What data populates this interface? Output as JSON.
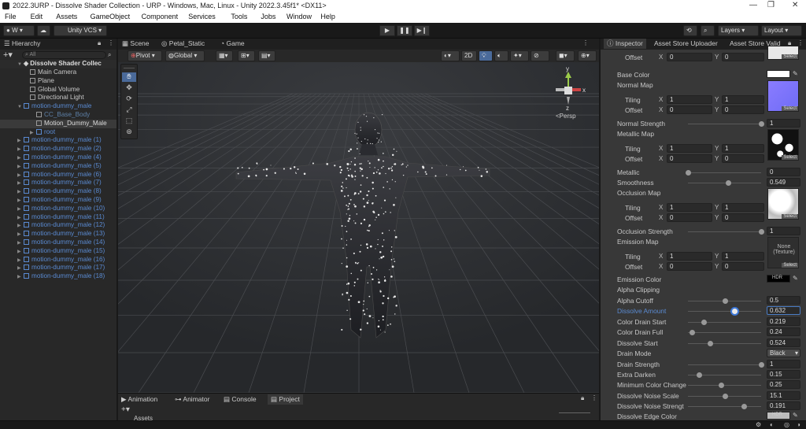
{
  "window": {
    "title": "2022.3URP - Dissolve Shader Collection - URP - Windows, Mac, Linux - Unity 2022.3.45f1* <DX11>"
  },
  "menu": [
    "File",
    "Edit",
    "Assets",
    "GameObject",
    "Component",
    "Services",
    "Tools",
    "Jobs",
    "Window",
    "Help"
  ],
  "toolbar": {
    "account": "W",
    "vcs": "Unity VCS",
    "layers": "Layers",
    "layout": "Layout"
  },
  "hierarchy": {
    "tab": "Hierarchy",
    "search_placeholder": "All",
    "scene": "Dissolve Shader Collec",
    "items": [
      {
        "label": "Main Camera",
        "style": "normal",
        "indent": 2
      },
      {
        "label": "Plane",
        "style": "normal",
        "indent": 2
      },
      {
        "label": "Global Volume",
        "style": "normal",
        "indent": 2
      },
      {
        "label": "Directional Light",
        "style": "normal",
        "indent": 2
      },
      {
        "label": "motion-dummy_male",
        "style": "blue",
        "indent": 1,
        "arrow": "▼"
      },
      {
        "label": "CC_Base_Body",
        "style": "dim",
        "indent": 3
      },
      {
        "label": "Motion_Dummy_Male",
        "style": "sel",
        "indent": 3
      },
      {
        "label": "root",
        "style": "blue",
        "indent": 3,
        "arrow": "▶"
      },
      {
        "label": "motion-dummy_male (1)",
        "style": "blue",
        "indent": 1,
        "arrow": "▶"
      },
      {
        "label": "motion-dummy_male (2)",
        "style": "blue",
        "indent": 1,
        "arrow": "▶"
      },
      {
        "label": "motion-dummy_male (4)",
        "style": "blue",
        "indent": 1,
        "arrow": "▶"
      },
      {
        "label": "motion-dummy_male (5)",
        "style": "blue",
        "indent": 1,
        "arrow": "▶"
      },
      {
        "label": "motion-dummy_male (6)",
        "style": "blue",
        "indent": 1,
        "arrow": "▶"
      },
      {
        "label": "motion-dummy_male (7)",
        "style": "blue",
        "indent": 1,
        "arrow": "▶"
      },
      {
        "label": "motion-dummy_male (8)",
        "style": "blue",
        "indent": 1,
        "arrow": "▶"
      },
      {
        "label": "motion-dummy_male (9)",
        "style": "blue",
        "indent": 1,
        "arrow": "▶"
      },
      {
        "label": "motion-dummy_male (10)",
        "style": "blue",
        "indent": 1,
        "arrow": "▶"
      },
      {
        "label": "motion-dummy_male (11)",
        "style": "blue",
        "indent": 1,
        "arrow": "▶"
      },
      {
        "label": "motion-dummy_male (12)",
        "style": "blue",
        "indent": 1,
        "arrow": "▶"
      },
      {
        "label": "motion-dummy_male (13)",
        "style": "blue",
        "indent": 1,
        "arrow": "▶"
      },
      {
        "label": "motion-dummy_male (14)",
        "style": "blue",
        "indent": 1,
        "arrow": "▶"
      },
      {
        "label": "motion-dummy_male (15)",
        "style": "blue",
        "indent": 1,
        "arrow": "▶"
      },
      {
        "label": "motion-dummy_male (16)",
        "style": "blue",
        "indent": 1,
        "arrow": "▶"
      },
      {
        "label": "motion-dummy_male (17)",
        "style": "blue",
        "indent": 1,
        "arrow": "▶"
      },
      {
        "label": "motion-dummy_male (18)",
        "style": "blue",
        "indent": 1,
        "arrow": "▶"
      }
    ]
  },
  "scene": {
    "tabs": [
      "Scene",
      "Petal_Static",
      "Game"
    ],
    "pivot": "Pivot",
    "global": "Global",
    "mode2d": "2D",
    "persp": "<Persp",
    "gizmo_axes": {
      "x": "x",
      "y": "y",
      "z": "z"
    }
  },
  "bottom": {
    "tabs": [
      "Animation",
      "Animator",
      "Console",
      "Project"
    ],
    "assets": "Assets"
  },
  "inspector": {
    "tabs": [
      "Inspector",
      "Asset Store Uploader",
      "Asset Store Valid"
    ],
    "rows": [
      {
        "type": "xy",
        "label": "Offset",
        "x": "0",
        "y": "0"
      },
      {
        "type": "color",
        "label": "Base Color",
        "color": "#ffffff"
      },
      {
        "type": "label",
        "label": "Normal Map"
      },
      {
        "type": "xy",
        "label": "Tiling",
        "x": "1",
        "y": "1"
      },
      {
        "type": "xy",
        "label": "Offset",
        "x": "0",
        "y": "0"
      },
      {
        "type": "slider",
        "label": "Normal Strength",
        "value": "1",
        "frac": 1.0
      },
      {
        "type": "label",
        "label": "Metallic Map"
      },
      {
        "type": "xy",
        "label": "Tiling",
        "x": "1",
        "y": "1"
      },
      {
        "type": "xy",
        "label": "Offset",
        "x": "0",
        "y": "0"
      },
      {
        "type": "slider",
        "label": "Metallic",
        "value": "0",
        "frac": 0.0
      },
      {
        "type": "slider",
        "label": "Smoothness",
        "value": "0.549",
        "frac": 0.549
      },
      {
        "type": "label",
        "label": "Occlusion Map"
      },
      {
        "type": "xy",
        "label": "Tiling",
        "x": "1",
        "y": "1"
      },
      {
        "type": "xy",
        "label": "Offset",
        "x": "0",
        "y": "0"
      },
      {
        "type": "slider",
        "label": "Occlusion Strength",
        "value": "1",
        "frac": 1.0
      },
      {
        "type": "label",
        "label": "Emission Map"
      },
      {
        "type": "xy",
        "label": "Tiling",
        "x": "1",
        "y": "1"
      },
      {
        "type": "xy",
        "label": "Offset",
        "x": "0",
        "y": "0"
      },
      {
        "type": "color",
        "label": "Emission Color",
        "color": "#000000",
        "hdr": "HDR"
      },
      {
        "type": "label",
        "label": "Alpha Clipping"
      },
      {
        "type": "slider",
        "label": "Alpha Cutoff",
        "value": "0.5",
        "frac": 0.5
      },
      {
        "type": "slider",
        "label": "Dissolve Amount",
        "value": "0.632",
        "frac": 0.632,
        "active": true
      },
      {
        "type": "slider",
        "label": "Color Drain Start",
        "value": "0.219",
        "frac": 0.219
      },
      {
        "type": "slider",
        "label": "Color Drain Full",
        "value": "0.24",
        "frac": 0.05
      },
      {
        "type": "slider",
        "label": "Dissolve Start",
        "value": "0.524",
        "frac": 0.3
      },
      {
        "type": "dropdown",
        "label": "Drain Mode",
        "value": "Black"
      },
      {
        "type": "slider",
        "label": "Drain Strength",
        "value": "1",
        "frac": 1.0
      },
      {
        "type": "slider",
        "label": "Extra Darken",
        "value": "0.15",
        "frac": 0.15
      },
      {
        "type": "slider",
        "label": "Minimum Color Change",
        "value": "0.25",
        "frac": 0.45
      },
      {
        "type": "slider",
        "label": "Dissolve Noise Scale",
        "value": "15.1",
        "frac": 0.5
      },
      {
        "type": "slider",
        "label": "Dissolve Noise Strengt",
        "value": "0.191",
        "frac": 0.76
      },
      {
        "type": "color",
        "label": "Dissolve Edge Color",
        "color": "#bdbdbd",
        "hdr": "HDR"
      }
    ],
    "textures": [
      {
        "row": 0,
        "kind": "white"
      },
      {
        "row": 2,
        "kind": "normal"
      },
      {
        "row": 6,
        "kind": "noise"
      },
      {
        "row": 11,
        "kind": "occ"
      },
      {
        "row": 15,
        "kind": "none",
        "none_label": "None",
        "none_sub": "(Texture)"
      }
    ],
    "select": "Select"
  }
}
